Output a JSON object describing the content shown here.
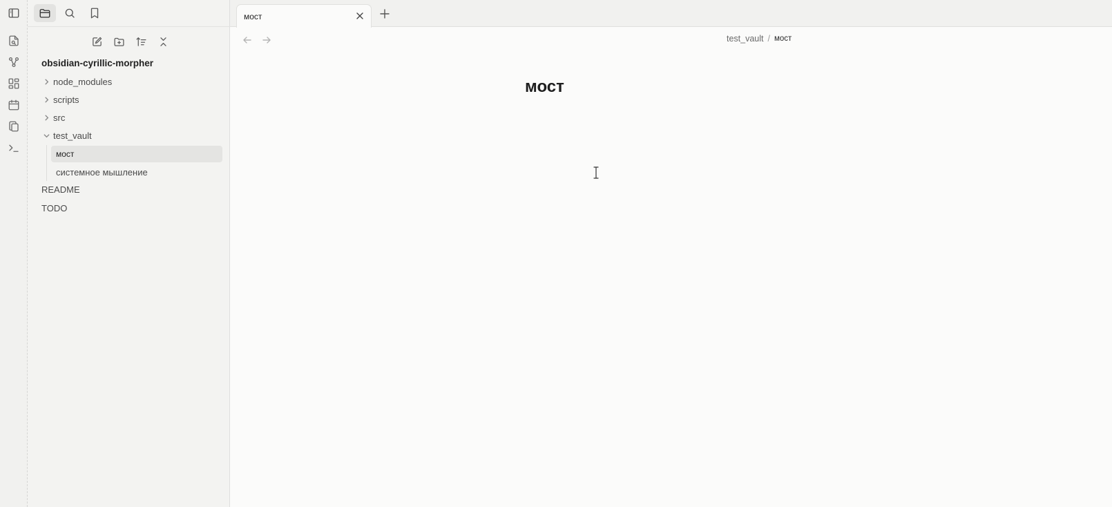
{
  "sidebar": {
    "tabs": [
      "files-tab",
      "search-tab",
      "bookmarks-tab"
    ],
    "vault_name": "obsidian-cyrillic-morpher",
    "tree": [
      {
        "label": "node_modules",
        "type": "folder",
        "expanded": false
      },
      {
        "label": "scripts",
        "type": "folder",
        "expanded": false
      },
      {
        "label": "src",
        "type": "folder",
        "expanded": false
      },
      {
        "label": "test_vault",
        "type": "folder",
        "expanded": true
      },
      {
        "label": "мост",
        "type": "file",
        "selected": true
      },
      {
        "label": "системное мышление",
        "type": "file"
      },
      {
        "label": "README",
        "type": "file"
      },
      {
        "label": "TODO",
        "type": "file"
      }
    ]
  },
  "tabs": [
    {
      "title": "мост",
      "active": true
    }
  ],
  "breadcrumb": {
    "folder": "test_vault",
    "separator": "/",
    "current": "мост"
  },
  "note": {
    "title": "мост"
  },
  "colors": {
    "background": "#fbfbfa",
    "sidebar": "#f3f3f1",
    "selected": "#e4e4e2"
  }
}
